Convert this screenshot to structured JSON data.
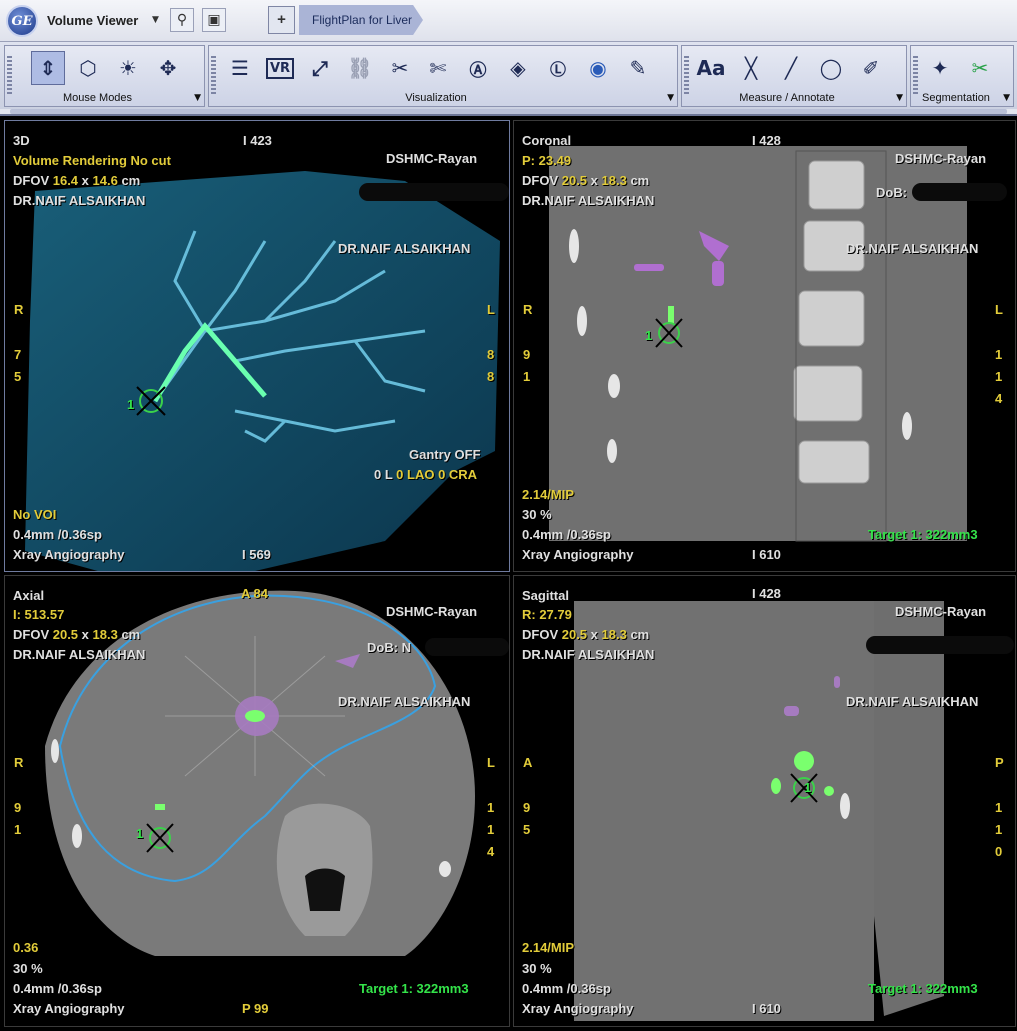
{
  "app": {
    "name": "Volume Viewer",
    "logo": "GE",
    "tab_label": "FlightPlan for Liver",
    "tab_add": "+"
  },
  "toolbar": {
    "groups": [
      {
        "label": "Mouse Modes",
        "tools": [
          "rotate-3d-icon",
          "orbit-icon",
          "window-level-icon",
          "pan-icon"
        ]
      },
      {
        "label": "Visualization",
        "tools": [
          "layers-icon",
          "vr-icon",
          "fit-icon",
          "link-icon",
          "cut-icon",
          "scissors-icon",
          "annotate-a-icon",
          "cube-icon",
          "l-cube-icon",
          "globe-icon",
          "brush-icon"
        ]
      },
      {
        "label": "Measure / Annotate",
        "tools": [
          "text-aa-icon",
          "cross-icon",
          "line-icon",
          "ellipse-icon",
          "trace-icon"
        ]
      },
      {
        "label": "Segmentation",
        "tools": [
          "wand-icon",
          "scissors-seg-icon"
        ]
      }
    ],
    "vr_text": "VR",
    "aa_text": "Aa"
  },
  "viewports": {
    "v3d": {
      "title": "3D",
      "top_label": "I 423",
      "subtitle": "Volume Rendering No cut",
      "dfov_prefix": "DFOV ",
      "dfov_w": "16.4",
      "dfov_x": " x ",
      "dfov_h": "14.6",
      "dfov_unit": " cm",
      "doctor": "DR.NAIF ALSAIKHAN",
      "site": "DSHMC-Rayan",
      "doctor_right": "DR.NAIF ALSAIKHAN",
      "left_r": "R",
      "left_n1": "7",
      "left_n2": "5",
      "right_l": "L",
      "right_n1": "8",
      "right_n2": "8",
      "gantry": "Gantry OFF",
      "angles_prefix": "0 L ",
      "angles_lao": "0 LAO 0 CRA",
      "voi": "No VOI",
      "thickness": "0.4mm /0.36sp",
      "modality": "Xray Angiography",
      "bottom_label": "I 569",
      "target_mark": "1"
    },
    "coronal": {
      "title": "Coronal",
      "top_label": "I 428",
      "pos": "P: 23.49",
      "dfov_prefix": "DFOV ",
      "dfov_w": "20.5",
      "dfov_x": " x ",
      "dfov_h": "18.3",
      "dfov_unit": " cm",
      "doctor": "DR.NAIF ALSAIKHAN",
      "site": "DSHMC-Rayan",
      "dob": "DoB:",
      "doctor_right": "DR.NAIF ALSAIKHAN",
      "left_r": "R",
      "left_n1": "9",
      "left_n2": "1",
      "right_l": "L",
      "right_n1": "1",
      "right_n2": "1",
      "right_n3": "4",
      "mip": "2.14/MIP",
      "pct": "30 %",
      "thickness": "0.4mm /0.36sp",
      "modality": "Xray Angiography",
      "bottom_label": "I 610",
      "target": "Target 1: 322mm3",
      "target_mark": "1"
    },
    "axial": {
      "title": "Axial",
      "top_label": "A 84",
      "pos": "I: 513.57",
      "dfov_prefix": "DFOV ",
      "dfov_w": "20.5",
      "dfov_x": " x ",
      "dfov_h": "18.3",
      "dfov_unit": " cm",
      "doctor": "DR.NAIF ALSAIKHAN",
      "site": "DSHMC-Rayan",
      "dob": "DoB: N",
      "doctor_right": "DR.NAIF ALSAIKHAN",
      "left_r": "R",
      "left_n1": "9",
      "left_n2": "1",
      "right_l": "L",
      "right_n1": "1",
      "right_n2": "1",
      "right_n3": "4",
      "mip": "0.36",
      "pct": "30 %",
      "thickness": "0.4mm /0.36sp",
      "modality": "Xray Angiography",
      "bottom_label": "P 99",
      "target": "Target 1: 322mm3",
      "target_mark": "1"
    },
    "sagittal": {
      "title": "Sagittal",
      "top_label": "I 428",
      "pos": "R: 27.79",
      "dfov_prefix": "DFOV ",
      "dfov_w": "20.5",
      "dfov_x": " x ",
      "dfov_h": "18.3",
      "dfov_unit": " cm",
      "doctor": "DR.NAIF ALSAIKHAN",
      "site": "DSHMC-Rayan",
      "doctor_right": "DR.NAIF ALSAIKHAN",
      "left_a": "A",
      "left_n1": "9",
      "left_n2": "5",
      "right_p": "P",
      "right_n1": "1",
      "right_n2": "1",
      "right_n3": "0",
      "mip": "2.14/MIP",
      "pct": "30 %",
      "thickness": "0.4mm /0.36sp",
      "modality": "Xray Angiography",
      "bottom_label": "I 610",
      "target": "Target 1: 322mm3",
      "target_mark": "1"
    }
  },
  "colors": {
    "overlay_text": "#e0e0e0",
    "overlay_value": "#e2cc3a",
    "target_green": "#34e44a",
    "vessel_blue": "#3aa9d0",
    "liver_outline": "#3aa0e0",
    "toolbar_bg": "#d3d8e8"
  }
}
